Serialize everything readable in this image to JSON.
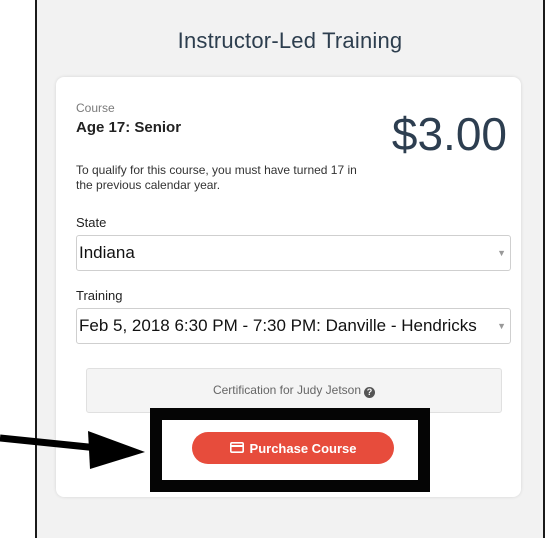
{
  "panel": {
    "title": "Instructor-Led Training"
  },
  "course": {
    "label": "Course",
    "name": "Age 17: Senior",
    "price": "$3.00",
    "qualification": "To qualify for this course, you must have turned 17 in the previous calendar year."
  },
  "state": {
    "label": "State",
    "selected": "Indiana"
  },
  "training": {
    "label": "Training",
    "selected": "Feb 5, 2018 6:30 PM - 7:30 PM: Danville - Hendricks"
  },
  "certification": {
    "text": "Certification for Judy Jetson"
  },
  "purchase": {
    "label": "Purchase Course"
  },
  "colors": {
    "accent": "#e74c3c",
    "price": "#2d3e50",
    "annotation": "#050505"
  },
  "icons": {
    "help": "question-circle-icon",
    "purchase": "credit-card-icon",
    "dropdown": "caret-down-icon",
    "pointer": "arrow-icon"
  }
}
